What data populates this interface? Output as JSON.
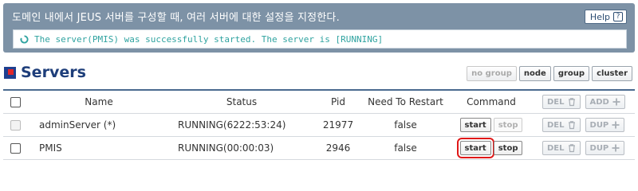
{
  "banner": {
    "title": "도메인 내에서 JEUS 서버를 구성할 때, 여러 서버에 대한 설정을 지정한다.",
    "help_label": "Help",
    "help_icon": "question-icon",
    "message": "The server(PMIS) was successfully started. The server is [RUNNING]",
    "message_icon": "refresh-icon"
  },
  "section": {
    "title": "Servers",
    "group_buttons": [
      "no group",
      "node",
      "group",
      "cluster"
    ]
  },
  "table": {
    "columns": {
      "name": "Name",
      "status": "Status",
      "pid": "Pid",
      "restart": "Need To Restart",
      "command": "Command"
    },
    "header_actions": {
      "del": "DEL",
      "add": "ADD"
    },
    "rows": [
      {
        "name": "adminServer (*)",
        "status": "RUNNING(6222:53:24)",
        "pid": "21977",
        "restart": "false",
        "start": "start",
        "stop": "stop",
        "del": "DEL",
        "dup": "DUP"
      },
      {
        "name": "PMIS",
        "status": "RUNNING(00:00:03)",
        "pid": "2946",
        "restart": "false",
        "start": "start",
        "stop": "stop",
        "del": "DEL",
        "dup": "DUP"
      }
    ]
  },
  "colors": {
    "banner_bg": "#7d92a6",
    "message_text": "#2fa3a0",
    "title_text": "#1e3e7a",
    "highlight": "#e01818"
  }
}
